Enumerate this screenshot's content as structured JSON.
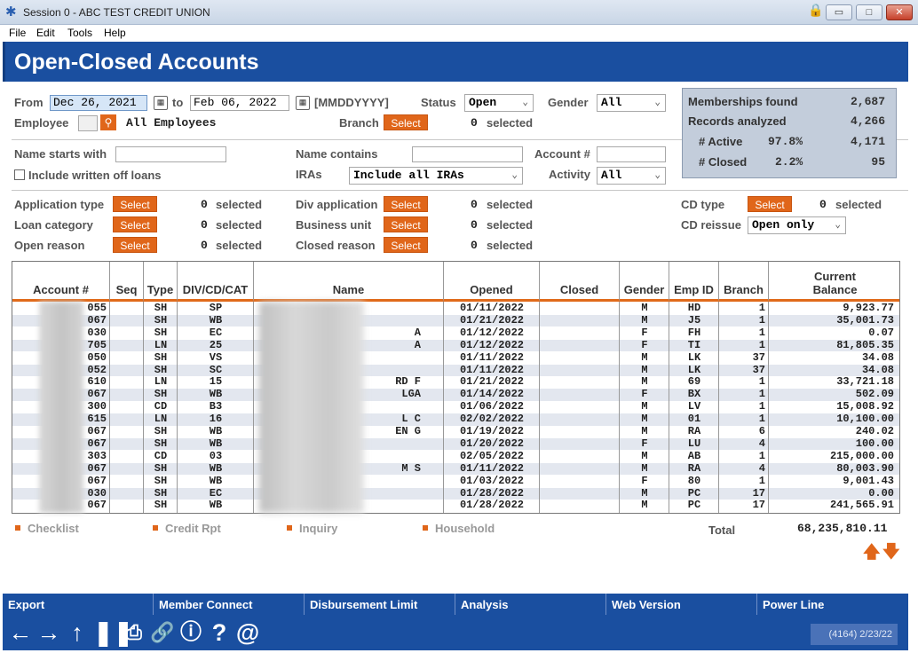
{
  "window": {
    "title": "Session 0 - ABC TEST CREDIT UNION"
  },
  "menu": [
    "File",
    "Edit",
    "Tools",
    "Help"
  ],
  "page_title": "Open-Closed Accounts",
  "filters": {
    "from_label": "From",
    "from_value": "Dec 26, 2021",
    "to_label": "to",
    "to_value": "Feb 06, 2022",
    "date_format": "[MMDDYYYY]",
    "status_label": "Status",
    "status_value": "Open",
    "gender_label": "Gender",
    "gender_value": "All",
    "employee_label": "Employee",
    "employee_value": "All Employees",
    "branch_label": "Branch",
    "branch_selected": "0",
    "selected_word": "selected",
    "name_starts_label": "Name starts with",
    "name_contains_label": "Name contains",
    "account_label": "Account #",
    "include_written_off": "Include written off loans",
    "iras_label": "IRAs",
    "iras_value": "Include all IRAs",
    "activity_label": "Activity",
    "activity_value": "All",
    "select_label": "Select",
    "application_type_label": "Application type",
    "application_type_count": "0",
    "loan_category_label": "Loan category",
    "loan_category_count": "0",
    "open_reason_label": "Open reason",
    "open_reason_count": "0",
    "div_application_label": "Div application",
    "div_application_count": "0",
    "business_unit_label": "Business unit",
    "business_unit_count": "0",
    "closed_reason_label": "Closed reason",
    "closed_reason_count": "0",
    "cd_type_label": "CD type",
    "cd_type_count": "0",
    "cd_reissue_label": "CD reissue",
    "cd_reissue_value": "Open only"
  },
  "summary": {
    "memberships_label": "Memberships found",
    "memberships_value": "2,687",
    "records_label": "Records analyzed",
    "records_value": "4,266",
    "active_label": "# Active",
    "active_pct": "97.8%",
    "active_value": "4,171",
    "closed_label": "# Closed",
    "closed_pct": "2.2%",
    "closed_value": "95"
  },
  "table": {
    "headers": [
      "Account #",
      "Seq",
      "Type",
      "DIV/CD/CAT",
      "Name",
      "Opened",
      "Closed",
      "Gender",
      "Emp ID",
      "Branch",
      "Current Balance"
    ],
    "rows": [
      [
        "055",
        "",
        "SH",
        "SP",
        "",
        "01/11/2022",
        "",
        "M",
        "HD",
        "1",
        "9,923.77"
      ],
      [
        "067",
        "",
        "SH",
        "WB",
        "",
        "01/21/2022",
        "",
        "M",
        "J5",
        "1",
        "35,001.73"
      ],
      [
        "030",
        "",
        "SH",
        "EC",
        "A",
        "01/12/2022",
        "",
        "F",
        "FH",
        "1",
        "0.07"
      ],
      [
        "705",
        "",
        "LN",
        "25",
        "A",
        "01/12/2022",
        "",
        "F",
        "TI",
        "1",
        "81,805.35"
      ],
      [
        "050",
        "",
        "SH",
        "VS",
        "",
        "01/11/2022",
        "",
        "M",
        "LK",
        "37",
        "34.08"
      ],
      [
        "052",
        "",
        "SH",
        "SC",
        "",
        "01/11/2022",
        "",
        "M",
        "LK",
        "37",
        "34.08"
      ],
      [
        "610",
        "",
        "LN",
        "15",
        "RD F",
        "01/21/2022",
        "",
        "M",
        "69",
        "1",
        "33,721.18"
      ],
      [
        "067",
        "",
        "SH",
        "WB",
        "LGA",
        "01/14/2022",
        "",
        "F",
        "BX",
        "1",
        "502.09"
      ],
      [
        "300",
        "",
        "CD",
        "B3",
        "",
        "01/06/2022",
        "",
        "M",
        "LV",
        "1",
        "15,008.92"
      ],
      [
        "615",
        "",
        "LN",
        "16",
        "L C",
        "02/02/2022",
        "",
        "M",
        "01",
        "1",
        "10,100.00"
      ],
      [
        "067",
        "",
        "SH",
        "WB",
        "EN G",
        "01/19/2022",
        "",
        "M",
        "RA",
        "6",
        "240.02"
      ],
      [
        "067",
        "",
        "SH",
        "WB",
        "",
        "01/20/2022",
        "",
        "F",
        "LU",
        "4",
        "100.00"
      ],
      [
        "303",
        "",
        "CD",
        "03",
        "",
        "02/05/2022",
        "",
        "M",
        "AB",
        "1",
        "215,000.00"
      ],
      [
        "067",
        "",
        "SH",
        "WB",
        "M S",
        "01/11/2022",
        "",
        "M",
        "RA",
        "4",
        "80,003.90"
      ],
      [
        "067",
        "",
        "SH",
        "WB",
        "",
        "01/03/2022",
        "",
        "F",
        "80",
        "1",
        "9,001.43"
      ],
      [
        "030",
        "",
        "SH",
        "EC",
        "",
        "01/28/2022",
        "",
        "M",
        "PC",
        "17",
        "0.00"
      ],
      [
        "067",
        "",
        "SH",
        "WB",
        "",
        "01/28/2022",
        "",
        "M",
        "PC",
        "17",
        "241,565.91"
      ]
    ]
  },
  "links": [
    "Checklist",
    "Credit Rpt",
    "Inquiry",
    "Household"
  ],
  "total_label": "Total",
  "total_value": "68,235,810.11",
  "tabs": [
    "Export",
    "Member Connect",
    "Disbursement Limit",
    "Analysis",
    "Web Version",
    "Power Line"
  ],
  "status_text": "(4164) 2/23/22",
  "colors": {
    "brand_blue": "#1a4fa0",
    "accent_orange": "#e0661a"
  }
}
